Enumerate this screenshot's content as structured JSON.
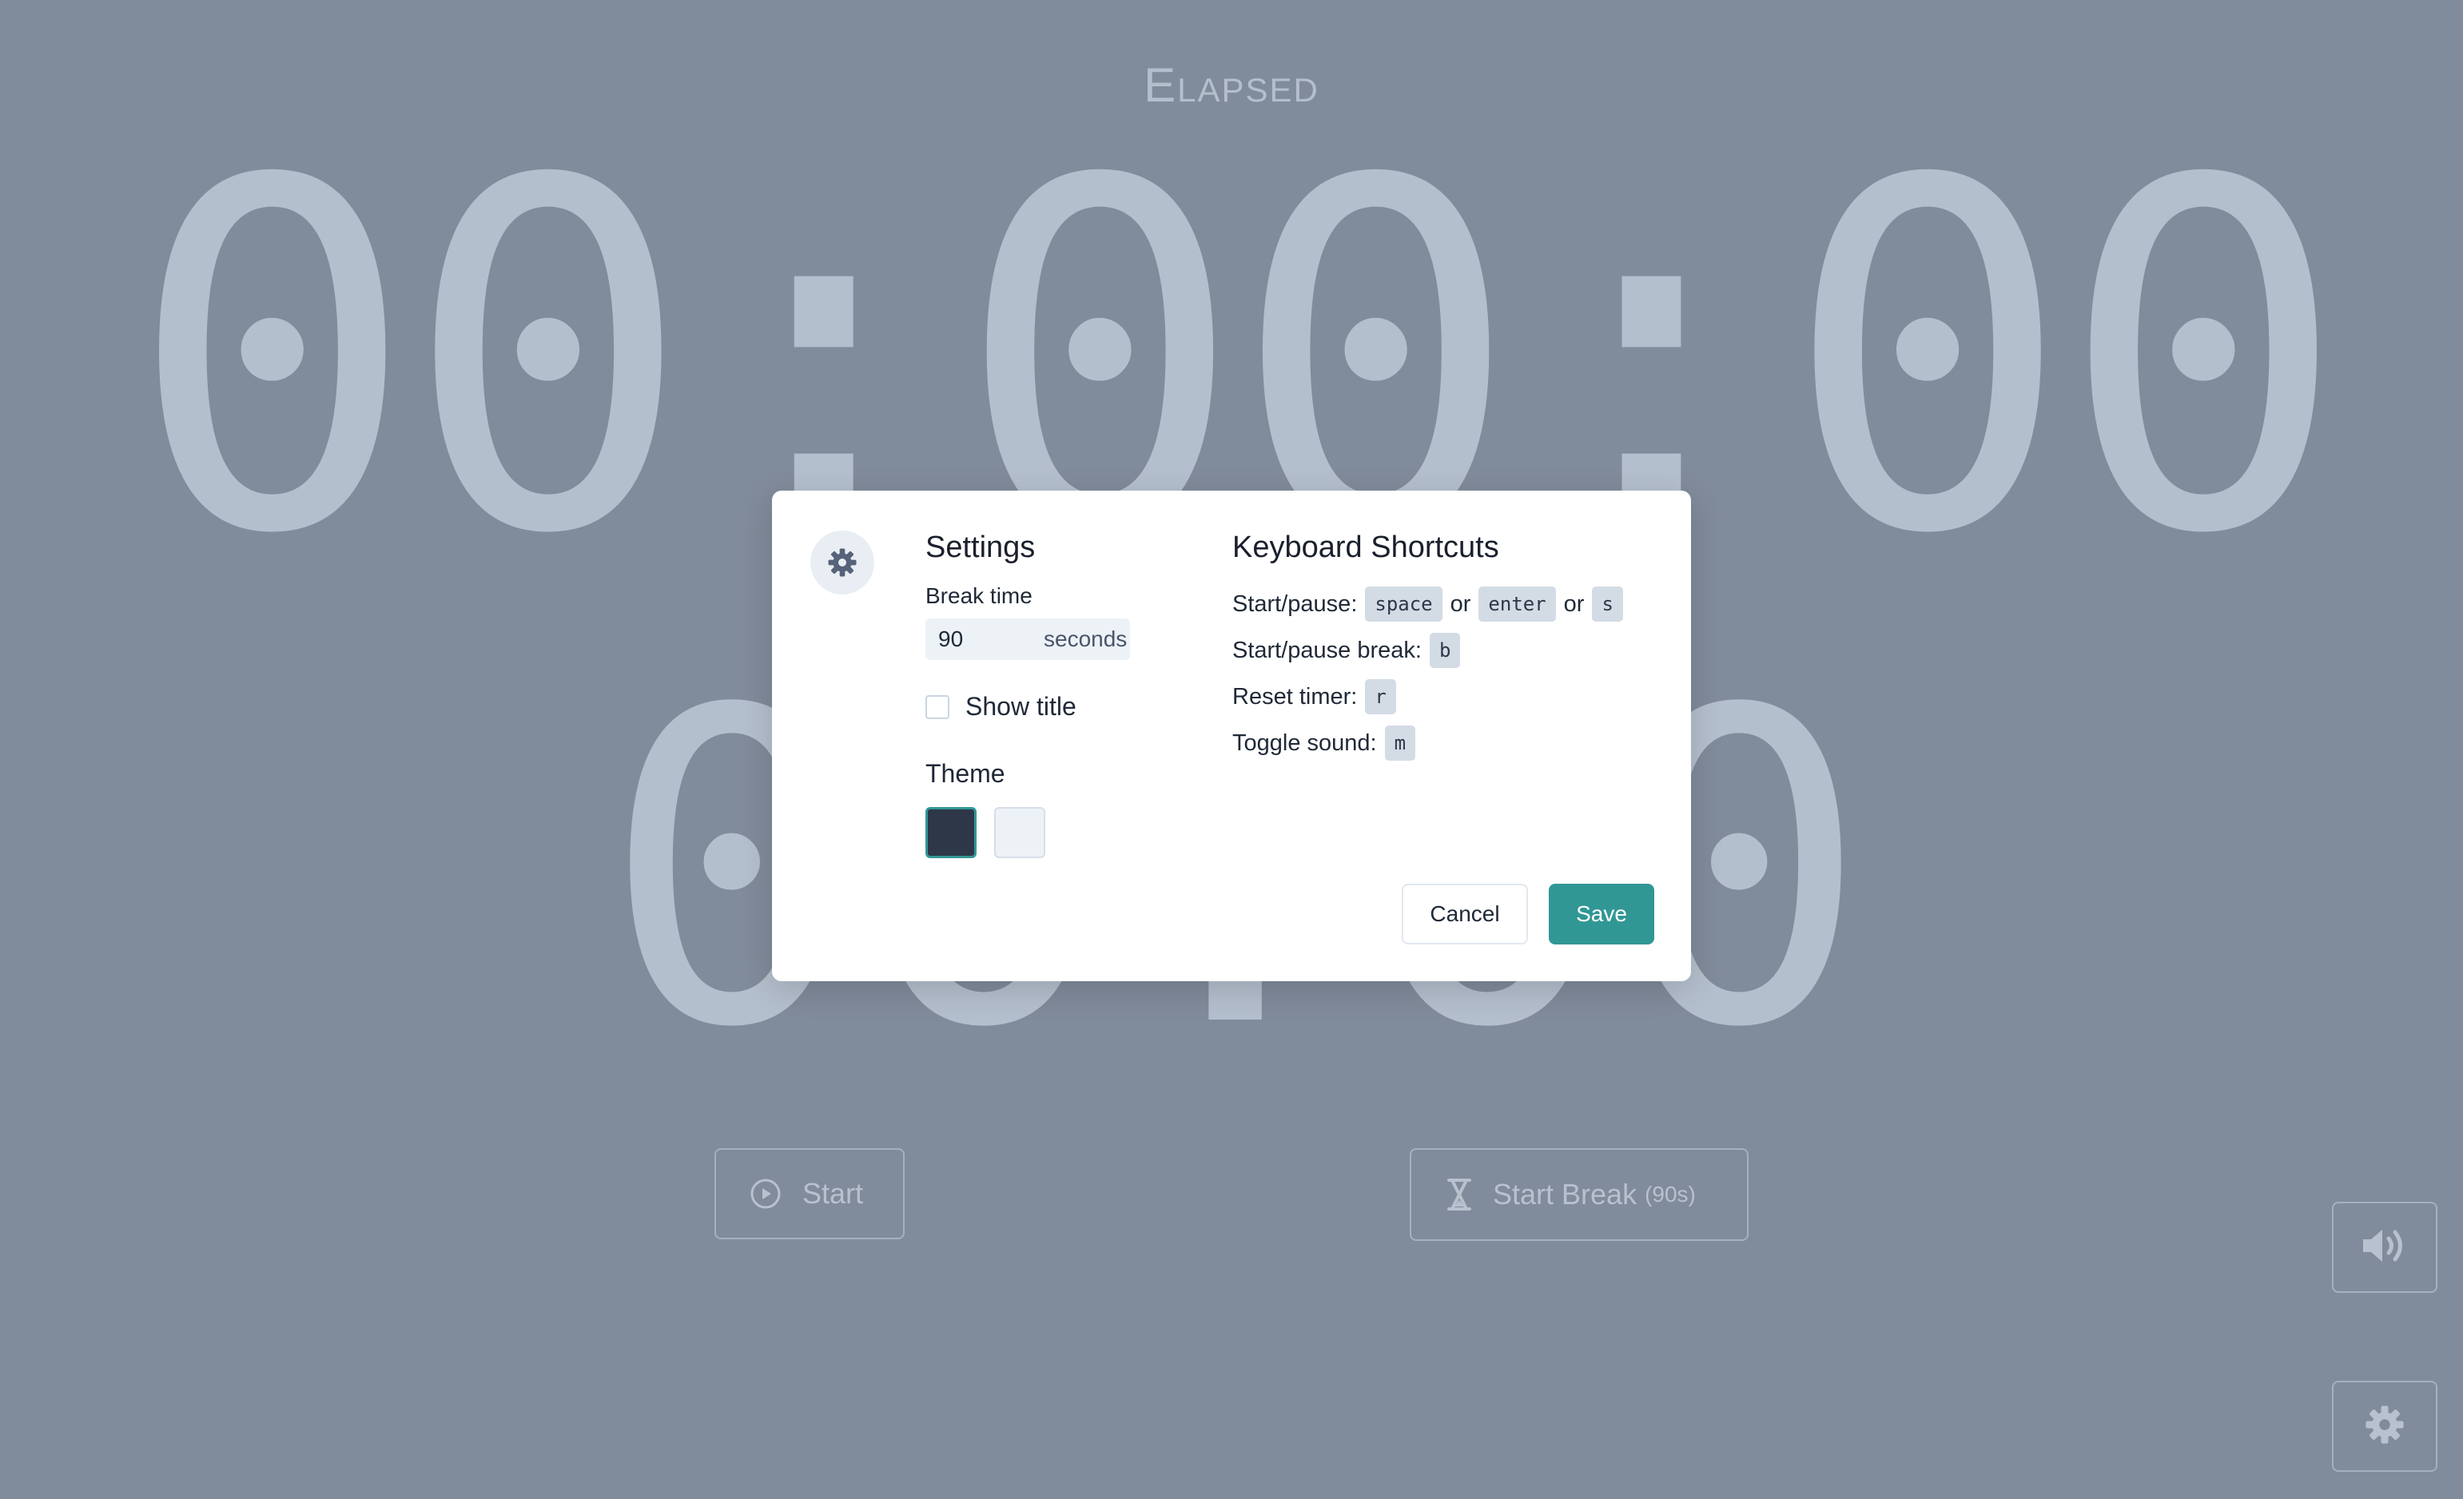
{
  "timer": {
    "label": "Elapsed",
    "main_value": "00:00:00",
    "break_value": "00:00"
  },
  "controls": {
    "start_label": "Start",
    "break_label": "Start Break",
    "break_duration": "(90s)"
  },
  "modal": {
    "settings": {
      "title": "Settings",
      "break_time_label": "Break time",
      "break_time_value": "90",
      "break_time_unit": "seconds",
      "show_title_label": "Show title",
      "show_title_checked": false,
      "theme_label": "Theme"
    },
    "shortcuts": {
      "title": "Keyboard Shortcuts",
      "or": "or",
      "start_pause": {
        "label": "Start/pause:",
        "keys": [
          "space",
          "enter",
          "s"
        ]
      },
      "start_pause_break": {
        "label": "Start/pause break:",
        "key": "b"
      },
      "reset_timer": {
        "label": "Reset timer:",
        "key": "r"
      },
      "toggle_sound": {
        "label": "Toggle sound:",
        "key": "m"
      }
    },
    "buttons": {
      "cancel": "Cancel",
      "save": "Save"
    }
  },
  "colors": {
    "background": "#808b9b",
    "digit": "#b4bfcd",
    "accent": "#319795",
    "theme_dark": "#2d3748",
    "theme_light": "#edf2f7"
  },
  "icons": {
    "modal": "gear-icon",
    "start": "play-circle-icon",
    "break": "hourglass-icon",
    "sound": "speaker-icon",
    "settings": "gear-icon"
  }
}
